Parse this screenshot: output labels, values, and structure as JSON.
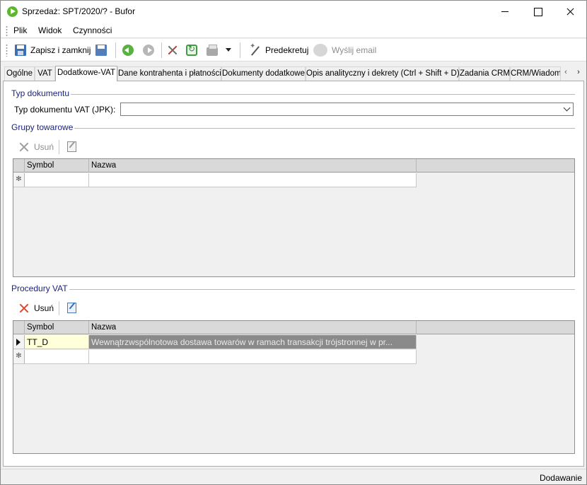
{
  "window": {
    "title": "Sprzedaż: SPT/2020/? - Bufor"
  },
  "menu": {
    "items": [
      "Plik",
      "Widok",
      "Czynności"
    ]
  },
  "toolbar": {
    "save_close": "Zapisz i zamknij",
    "predekretuj": "Predekretuj",
    "send_email": "Wyślij email"
  },
  "tabs": [
    {
      "label": "Ogólne",
      "active": false
    },
    {
      "label": "VAT",
      "active": false
    },
    {
      "label": "Dodatkowe-VAT",
      "active": true
    },
    {
      "label": "Dane kontrahenta i płatności",
      "active": false
    },
    {
      "label": "Dokumenty dodatkowe",
      "active": false
    },
    {
      "label": "Opis analityczny i dekrety (Ctrl + Shift + D)",
      "active": false
    },
    {
      "label": "Zadania CRM",
      "active": false
    },
    {
      "label": "CRM/Wiadomo",
      "active": false
    }
  ],
  "typ_dokumentu": {
    "group_title": "Typ dokumentu",
    "field_label": "Typ dokumentu VAT (JPK):",
    "value": ""
  },
  "grupy_towarowe": {
    "group_title": "Grupy towarowe",
    "remove_label": "Usuń",
    "columns": [
      "Symbol",
      "Nazwa"
    ],
    "new_row_marker": "✻"
  },
  "procedury_vat": {
    "group_title": "Procedury VAT",
    "remove_label": "Usuń",
    "columns": [
      "Symbol",
      "Nazwa"
    ],
    "rows": [
      {
        "symbol": "TT_D",
        "nazwa": "Wewnątrzwspólnotowa dostawa towarów w ramach transakcji trójstronnej w pr..."
      }
    ],
    "new_row_marker": "✻"
  },
  "status": {
    "mode": "Dodawanie"
  }
}
